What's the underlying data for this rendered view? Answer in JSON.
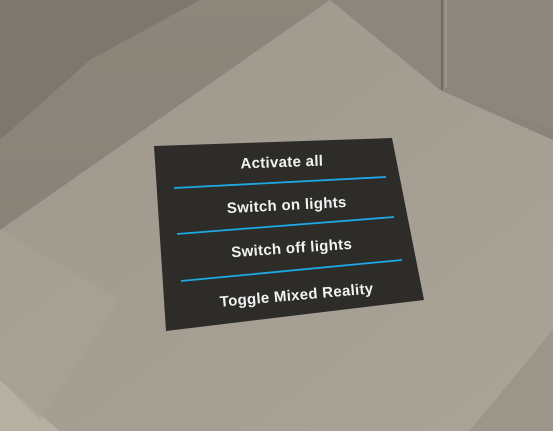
{
  "menu": {
    "items": [
      {
        "label": "Activate all"
      },
      {
        "label": "Switch on lights"
      },
      {
        "label": "Switch off lights"
      },
      {
        "label": "Toggle Mixed Reality"
      }
    ]
  },
  "colors": {
    "panel_background": "#2d2c29",
    "divider": "#1ea8e6",
    "floor": "#a59f93",
    "wall": "#878277"
  }
}
